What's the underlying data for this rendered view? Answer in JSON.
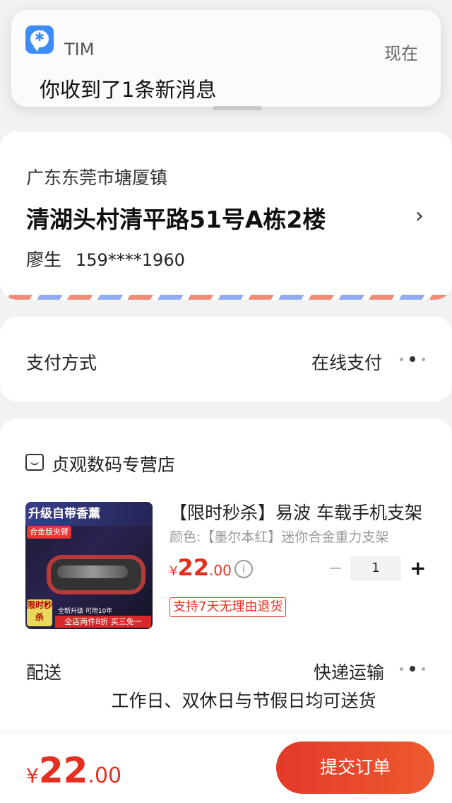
{
  "notification": {
    "app_name": "TIM",
    "time": "现在",
    "message": "你收到了1条新消息"
  },
  "address": {
    "region": "广东东莞市塘厦镇",
    "detail": "清湖头村清平路51号A栋2楼",
    "chevron": "›",
    "name": "廖生",
    "phone": "159****1960"
  },
  "payment": {
    "label": "支付方式",
    "value": "在线支付"
  },
  "store": {
    "name": "贞观数码专营店",
    "item": {
      "thumb_banner": "升级自带香薰",
      "thumb_sub": "合金版夹臂",
      "thumb_badge": "限时秒杀",
      "thumb_promo1": "全新升级  可用10年",
      "thumb_promo2": "全店两件8折 买三免一",
      "title": "【限时秒杀】易波 车载手机支架",
      "spec": "颜色:【墨尔本红】迷你合金重力支架",
      "price_symbol": "¥",
      "price_int": "22",
      "price_dec": ".00",
      "quantity": "1",
      "minus": "−",
      "plus": "+",
      "return_tag": "支持7天无理由退货"
    },
    "shipping": {
      "label": "配送",
      "value": "快递运输",
      "note": "工作日、双休日与节假日均可送货"
    }
  },
  "bottom_bar": {
    "total_symbol": "¥",
    "total_int": "22",
    "total_dec": ".00",
    "submit_label": "提交订单"
  },
  "colors": {
    "accent": "#e5301f",
    "notification_icon": "#3e8cf7"
  }
}
